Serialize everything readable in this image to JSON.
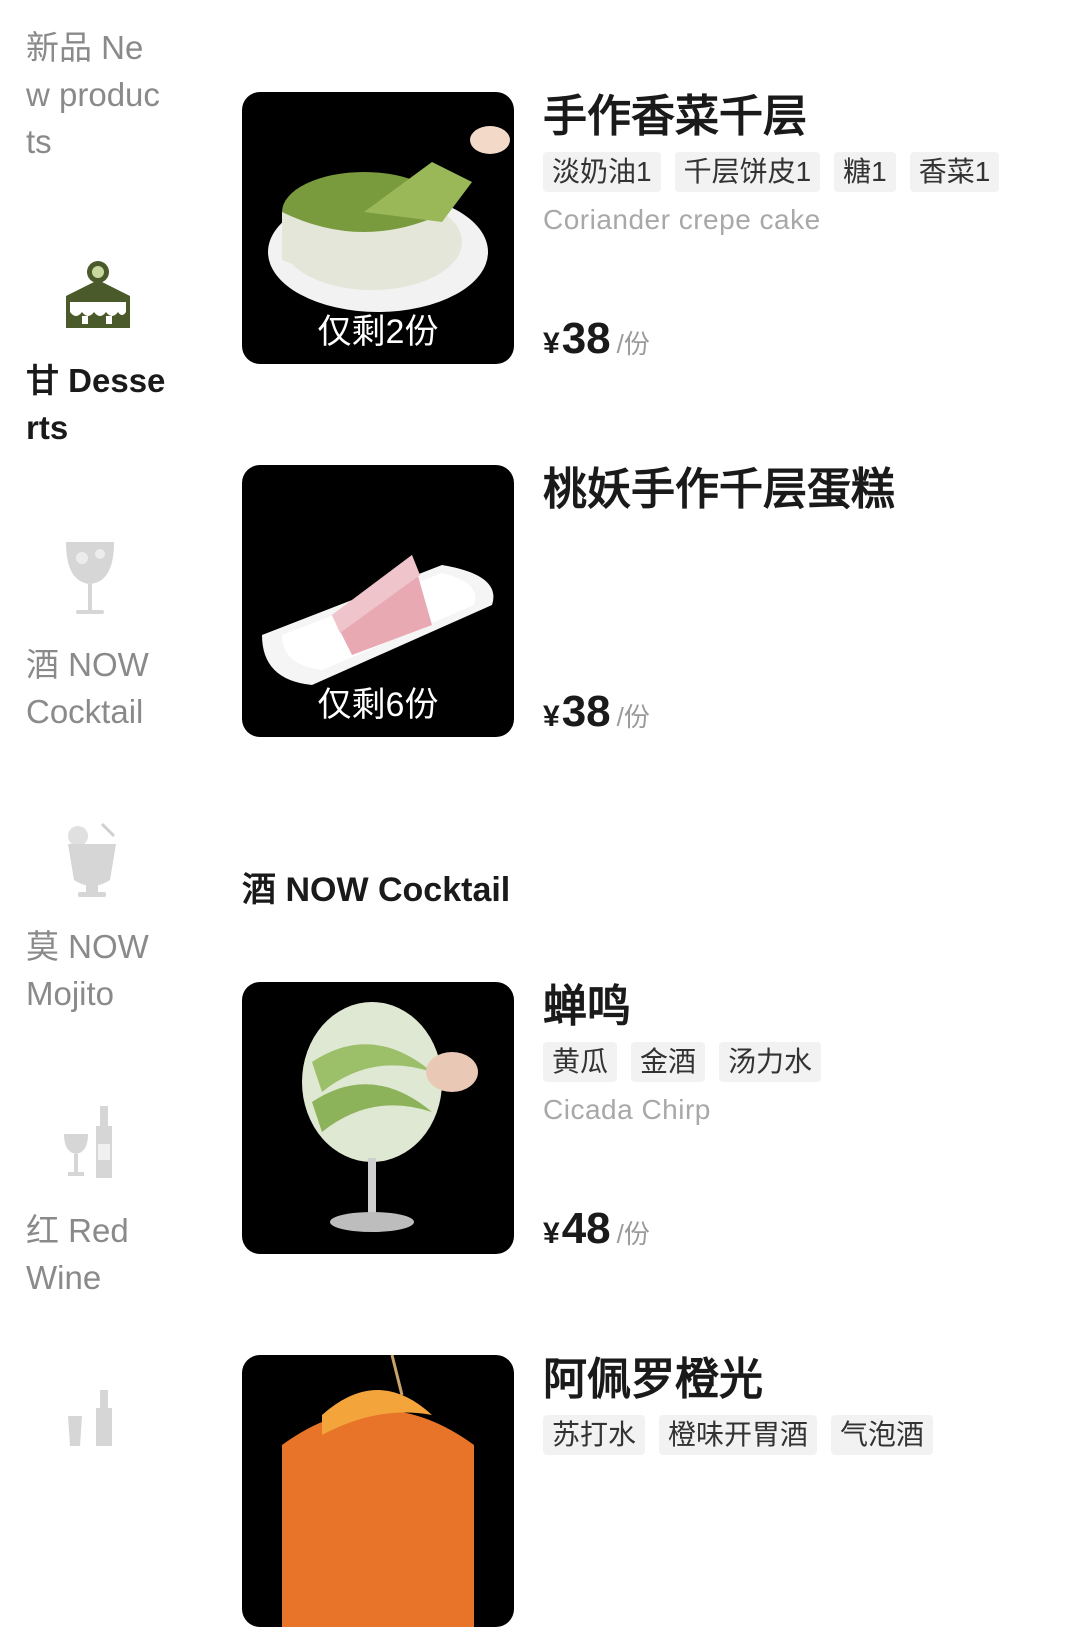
{
  "sidebar": {
    "items": [
      {
        "label": "新品 New products",
        "icon": "none",
        "active": false
      },
      {
        "label": "甘 Desserts",
        "icon": "cake-icon",
        "active": true
      },
      {
        "label": "酒 NOW Cocktail",
        "icon": "wine-glass-icon",
        "active": false
      },
      {
        "label": "莫 NOW Mojito",
        "icon": "mojito-icon",
        "active": false
      },
      {
        "label": "红 Red Wine",
        "icon": "wine-bottle-icon",
        "active": false
      },
      {
        "label": "",
        "icon": "champagne-icon",
        "active": false
      }
    ]
  },
  "products": [
    {
      "title": "手作香菜千层",
      "tags": [
        "淡奶油1",
        "千层饼皮1",
        "糖1",
        "香菜1"
      ],
      "subtitle": "Coriander crepe cake",
      "stock": "仅剩2份",
      "price": {
        "currency": "¥",
        "amount": "38",
        "unit": "/份"
      }
    },
    {
      "title": "桃妖手作千层蛋糕",
      "tags": [],
      "subtitle": "",
      "stock": "仅剩6份",
      "price": {
        "currency": "¥",
        "amount": "38",
        "unit": "/份"
      }
    },
    {
      "title": "蝉鸣",
      "tags": [
        "黄瓜",
        "金酒",
        "汤力水"
      ],
      "subtitle": "Cicada Chirp",
      "stock": "",
      "price": {
        "currency": "¥",
        "amount": "48",
        "unit": "/份"
      }
    },
    {
      "title": "阿佩罗橙光",
      "tags": [
        "苏打水",
        "橙味开胃酒",
        "气泡酒"
      ],
      "subtitle": "",
      "stock": "",
      "price": {
        "currency": "",
        "amount": "",
        "unit": ""
      }
    }
  ],
  "section": {
    "title": "酒 NOW Cocktail"
  },
  "colors": {
    "accent": "#4a5a2a",
    "muted": "#8a8a8a",
    "tag_bg": "#f2f2f2"
  }
}
